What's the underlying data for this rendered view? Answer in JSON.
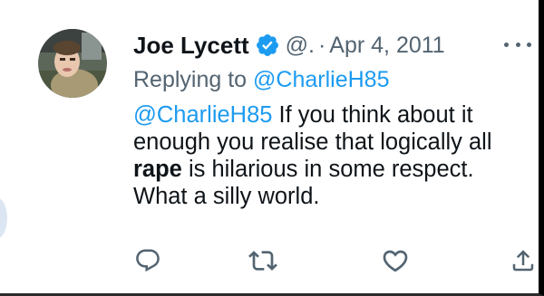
{
  "tweet": {
    "display_name": "Joe Lycett",
    "handle": "@.",
    "separator": "·",
    "date": "Apr 4, 2011",
    "replying_label": "Replying to",
    "replying_to": "@CharlieH85",
    "body": {
      "mention": "@CharlieH85",
      "text_1": " If you think about it enough you realise that logically all ",
      "bold": "rape",
      "text_2": " is hilarious in some respect. What a silly world."
    }
  },
  "icons": {
    "verified": "verified-badge-icon",
    "more": "more-options-icon",
    "reply": "reply-icon",
    "retweet": "retweet-icon",
    "like": "heart-icon",
    "share": "share-icon"
  },
  "colors": {
    "link": "#1d9bf0",
    "secondary_text": "#536471",
    "primary_text": "#0f1419",
    "verified": "#1d9bf0"
  }
}
